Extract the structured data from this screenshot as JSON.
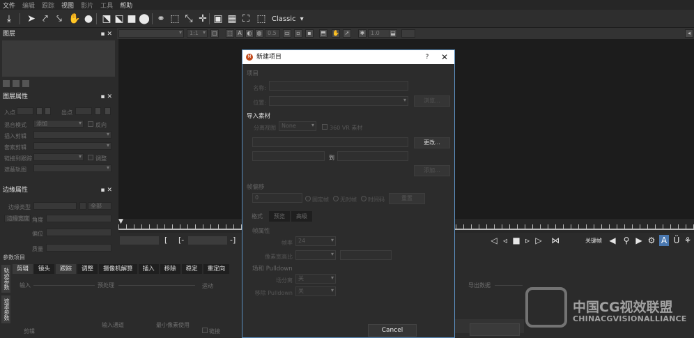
{
  "menu": {
    "items": [
      "文件",
      "编辑",
      "跟踪",
      "视图",
      "影片",
      "工具",
      "帮助"
    ]
  },
  "toolbar": {
    "workspace_label": "Classic",
    "icons": [
      "import-icon",
      "select-icon",
      "add-point-icon",
      "remove-point-icon",
      "hand-icon",
      "dot-icon",
      "transform-icon",
      "shear-icon",
      "fill-icon",
      "circle-icon",
      "link-icon",
      "split-icon",
      "scale-icon",
      "move-icon",
      "frame-icon",
      "grid-icon",
      "expand-icon",
      "corner-frame-icon"
    ]
  },
  "toolbar2": {
    "zoom": "1:1",
    "opacity": "0.5",
    "value": "1.0"
  },
  "layers_panel": {
    "title": "图层"
  },
  "layer_props": {
    "title": "图层属性",
    "in_label": "入点",
    "out_label": "出点",
    "blend_label": "混合模式",
    "blend_value": "添加",
    "invert_label": "反向",
    "insert_label": "插入剪辑",
    "replace_label": "套索剪辑",
    "link_label": "链接到跟踪",
    "adjust_label": "调整",
    "matte_label": "遮蔽轨图"
  },
  "edge_props": {
    "title": "边缘属性",
    "edge_label": "边缘类型",
    "edge_value": "全部",
    "edge_width_label": "边缘宽度",
    "angle_label": "角度",
    "offset_label": "偏位",
    "quality_label": "质量"
  },
  "timeline": {
    "start_marker": "[",
    "start_bracket": "[-",
    "end_bracket": "-]",
    "right_bracket": "]",
    "track_label": "跟踪",
    "keyframe_label": "关键帧"
  },
  "bottom": {
    "title": "参数项目",
    "tabs": [
      "剪辑",
      "镜头",
      "跟踪",
      "调整",
      "摄像机解算",
      "插入",
      "移除",
      "稳定",
      "重定向"
    ],
    "vertical_tabs": [
      "轨迹参数",
      "遮罩参数"
    ],
    "col_input": "输入",
    "col_preprocess": "预处理",
    "col_motion": "运动",
    "col_export": "导出数据",
    "row_clip": "剪辑",
    "row_input_channel": "输入通道",
    "row_min_pixels": "最小像素使用",
    "row_link": "链接"
  },
  "dialog": {
    "title": "新建项目",
    "help": "?",
    "close": "✕",
    "project_section": "项目",
    "name_label": "名称:",
    "location_label": "位置:",
    "browse_label": "浏览...",
    "import_section": "导入素材",
    "split_view_label": "分离视图",
    "split_view_value": "None",
    "vr_label": "360 VR 素材",
    "change_label": "更改...",
    "to_label": "到",
    "add_label": "添加...",
    "frame_offset_section": "帧偏移",
    "frame_offset_value": "0",
    "fixed_frame_label": "固定帧",
    "no_time_label": "无时帧",
    "timecode_label": "时间码",
    "reset_label": "重置",
    "tabs": [
      "格式",
      "预览",
      "高级"
    ],
    "frame_props_section": "帧属性",
    "frame_rate_label": "帧率",
    "frame_rate_value": "24",
    "pixel_aspect_label": "像素宽高比",
    "pulldown_section": "场和 Pulldown",
    "field_label": "场分离",
    "field_value": "关",
    "remove_pulldown_label": "移除 Pulldown",
    "remove_pulldown_value": "关",
    "cancel_label": "Cancel"
  },
  "watermark": {
    "cn": "中国CG视效联盟",
    "en": "CHINACGVISIONALLIANCE"
  },
  "colors": {
    "accent_border": "#5b8fbf",
    "background": "#2b2b2b",
    "viewer": "#1c1c1c"
  }
}
